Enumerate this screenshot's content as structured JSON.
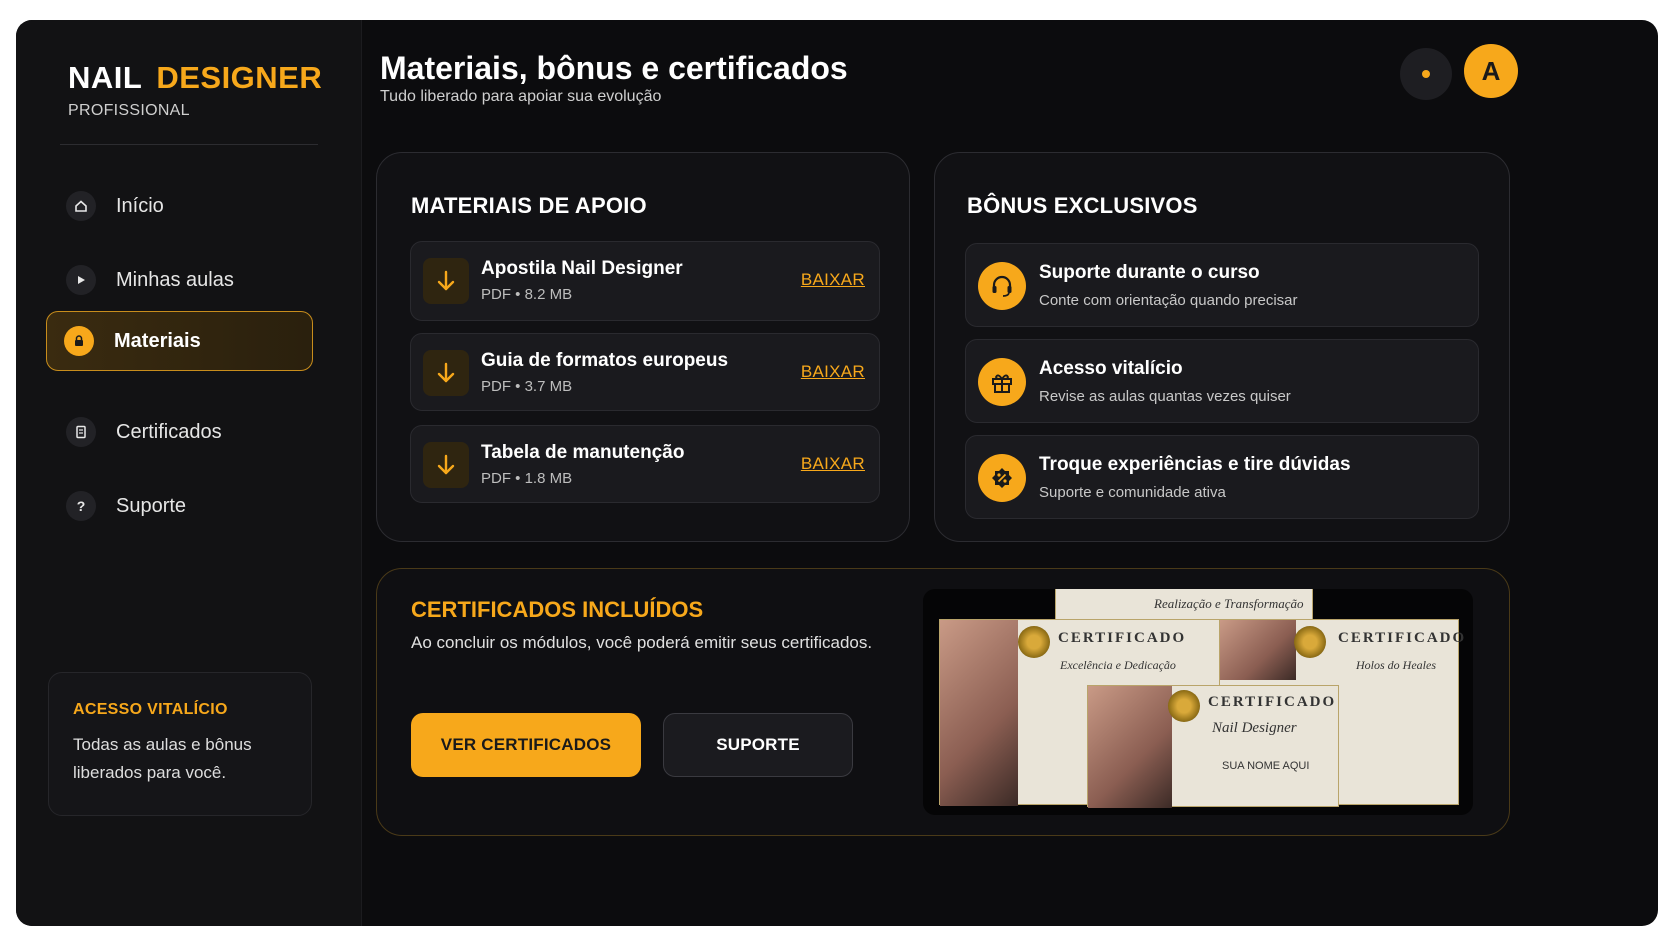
{
  "brand": {
    "word1": "NAIL",
    "word2": "DESIGNER",
    "subtitle": "PROFISSIONAL"
  },
  "nav": [
    {
      "label": "Início",
      "icon": "home-icon",
      "active": false
    },
    {
      "label": "Minhas aulas",
      "icon": "play-icon",
      "active": false
    },
    {
      "label": "Materiais",
      "icon": "lock-icon",
      "active": true
    },
    {
      "label": "Certificados",
      "icon": "document-icon",
      "active": false
    },
    {
      "label": "Suporte",
      "icon": "question-icon",
      "active": false
    }
  ],
  "access_card": {
    "title": "ACESSO VITALÍCIO",
    "text": "Todas as aulas e bônus liberados para você."
  },
  "header": {
    "title": "Materiais, bônus e certificados",
    "subtitle": "Tudo liberado para apoiar sua evolução",
    "avatar_initial": "A"
  },
  "materials": {
    "title": "MATERIAIS DE APOIO",
    "items": [
      {
        "title": "Apostila Nail Designer",
        "meta": "PDF • 8.2 MB",
        "action": "BAIXAR"
      },
      {
        "title": "Guia de formatos europeus",
        "meta": "PDF • 3.7 MB",
        "action": "BAIXAR"
      },
      {
        "title": "Tabela de manutenção",
        "meta": "PDF • 1.8 MB",
        "action": "BAIXAR"
      }
    ]
  },
  "bonus": {
    "title": "BÔNUS EXCLUSIVOS",
    "items": [
      {
        "title": "Suporte durante o curso",
        "desc": "Conte com orientação quando precisar",
        "icon": "headset-icon"
      },
      {
        "title": "Acesso vitalício",
        "desc": "Revise as aulas quantas vezes quiser",
        "icon": "gift-icon"
      },
      {
        "title": "Troque experiências e tire dúvidas",
        "desc": "Suporte e comunidade ativa",
        "icon": "percent-badge-icon"
      }
    ]
  },
  "certificates": {
    "title": "CERTIFICADOS INCLUÍDOS",
    "text": "Ao concluir os módulos, você poderá emitir seus certificados.",
    "primary_button": "VER CERTIFICADOS",
    "secondary_button": "SUPORTE",
    "preview": {
      "back_script": "Realização e Transformação",
      "card1_title": "CERTIFICADO",
      "card1_script": "Excelência e Dedicação",
      "card2_title": "CERTIFICADO",
      "card2_script": "Holos do Heales",
      "card3_title": "CERTIFICADO",
      "card3_script": "Nail Designer",
      "card3_name": "SUA NOME AQUI"
    }
  },
  "colors": {
    "accent": "#f7a81b",
    "background": "#0c0c0e",
    "panel": "#111114"
  }
}
